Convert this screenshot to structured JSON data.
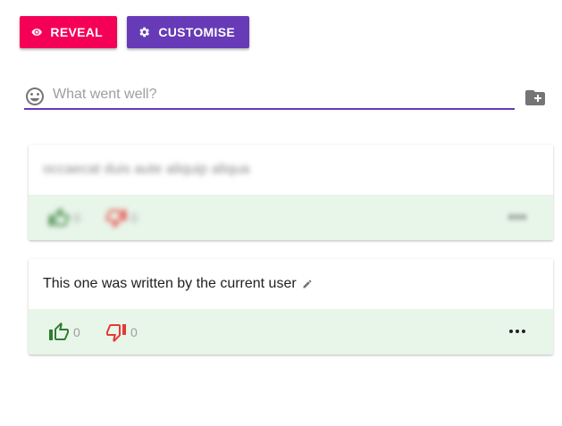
{
  "toolbar": {
    "reveal": {
      "label": "REVEAL",
      "icon": "eye-icon",
      "color": "#f50057"
    },
    "customise": {
      "label": "CUSTOMISE",
      "icon": "gear-icon",
      "color": "#673ab7"
    }
  },
  "input": {
    "placeholder": "What went well?",
    "value": "",
    "icon": "smiley-icon",
    "underline_color": "#673ab7",
    "action_icon": "create-new-folder-icon"
  },
  "posts": [
    {
      "text": "occaecat duis aute aliquip aliqua",
      "blurred": true,
      "likes": "0",
      "dislikes": "0",
      "menu_icon": "more-horizontal-icon"
    },
    {
      "text": "This one was written by the current user",
      "blurred": false,
      "editable": true,
      "edit_icon": "pencil-icon",
      "likes": "0",
      "dislikes": "0",
      "menu_icon": "more-horizontal-icon"
    }
  ],
  "colors": {
    "actions_bg": "#e8f5e9",
    "like": "#2e7d32",
    "dislike": "#e53935"
  }
}
